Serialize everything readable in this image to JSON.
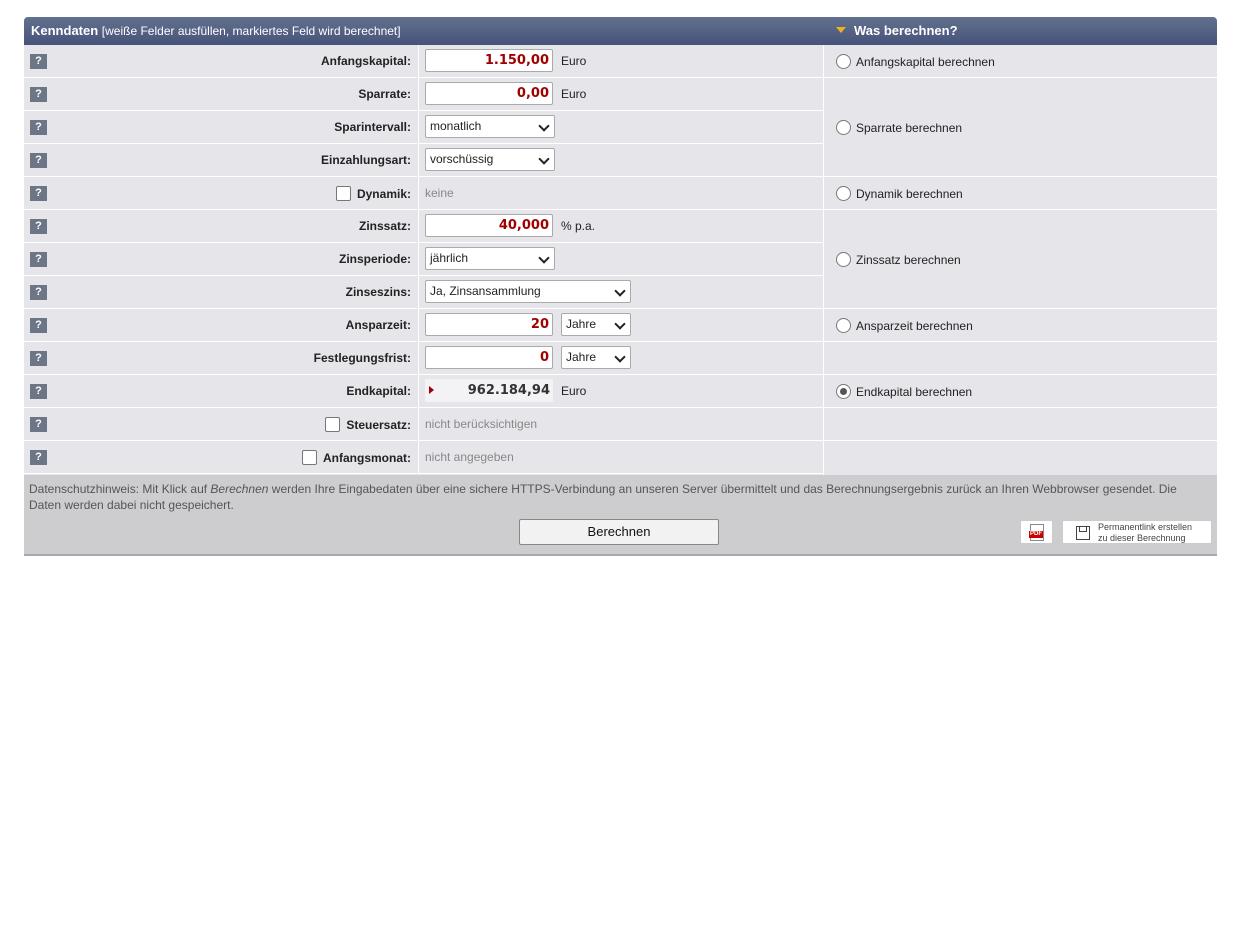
{
  "header": {
    "title": "Kenndaten",
    "subtitle": "[weiße Felder ausfüllen, markiertes Feld wird berechnet]",
    "right_title": "Was berechnen?"
  },
  "help_label": "?",
  "rows": {
    "anfangskapital": {
      "label": "Anfangskapital:",
      "value": "1.150,00",
      "unit": "Euro"
    },
    "sparrate": {
      "label": "Sparrate:",
      "value": "0,00",
      "unit": "Euro"
    },
    "sparintervall": {
      "label": "Sparintervall:",
      "value": "monatlich"
    },
    "einzahlungsart": {
      "label": "Einzahlungsart:",
      "value": "vorschüssig"
    },
    "dynamik": {
      "label": "Dynamik:",
      "value": "keine"
    },
    "zinssatz": {
      "label": "Zinssatz:",
      "value": "40,000",
      "unit": "% p.a."
    },
    "zinsperiode": {
      "label": "Zinsperiode:",
      "value": "jährlich"
    },
    "zinseszins": {
      "label": "Zinseszins:",
      "value": "Ja, Zinsansammlung"
    },
    "ansparzeit": {
      "label": "Ansparzeit:",
      "value": "20",
      "unit": "Jahre"
    },
    "festlegungsfrist": {
      "label": "Festlegungsfrist:",
      "value": "0",
      "unit": "Jahre"
    },
    "endkapital": {
      "label": "Endkapital:",
      "value": "962.184,94",
      "unit": "Euro"
    },
    "steuersatz": {
      "label": "Steuersatz:",
      "value": "nicht berücksichtigen"
    },
    "anfangsmonat": {
      "label": "Anfangsmonat:",
      "value": "nicht angegeben"
    }
  },
  "calc_options": {
    "anfangskapital": "Anfangskapital berechnen",
    "sparrate": "Sparrate berechnen",
    "dynamik": "Dynamik berechnen",
    "zinssatz": "Zinssatz berechnen",
    "ansparzeit": "Ansparzeit berechnen",
    "endkapital": "Endkapital berechnen",
    "selected": "endkapital"
  },
  "footer": {
    "note_pre": "Datenschutzhinweis: Mit Klick auf ",
    "note_em": "Berechnen",
    "note_post": " werden Ihre Eingabedaten über eine sichere HTTPS-Verbindung an unseren Server übermittelt und das Berechnungsergebnis zurück an Ihren Webbrowser gesendet. Die Daten werden dabei nicht gespeichert.",
    "button": "Berechnen",
    "pdf_label": "PDF",
    "permalink_line1": "Permanentlink erstellen",
    "permalink_line2": "zu dieser Berechnung"
  },
  "icons": {
    "help": "question-icon",
    "pdf": "pdf-icon",
    "permalink": "floppy-disk-icon",
    "dropdown": "chevron-down-icon",
    "section": "triangle-down-icon"
  },
  "colors": {
    "header_bg": "#4f5c80",
    "value_red": "#a00000",
    "panel_bg": "#e6e5ea",
    "footer_bg": "#cdcdd0",
    "accent_triangle": "#f2b01e"
  }
}
